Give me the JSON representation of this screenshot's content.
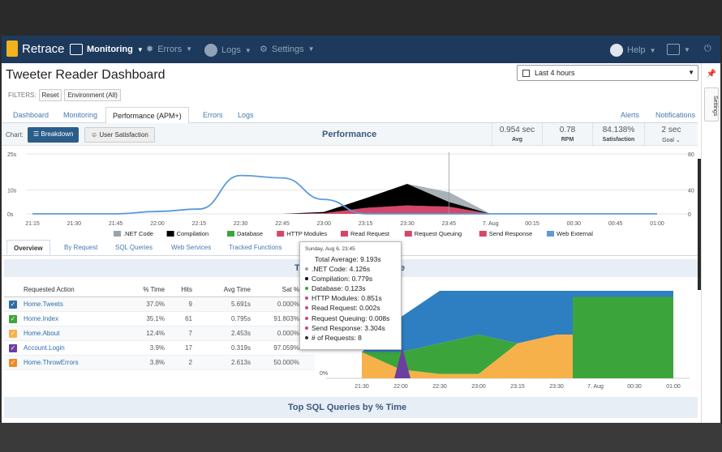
{
  "app": {
    "brand": "Retrace",
    "nav": {
      "monitoring": "Monitoring",
      "errors": "Errors",
      "logs": "Logs",
      "settings": "Settings",
      "help": "Help"
    }
  },
  "page": {
    "title": "Tweeter Reader Dashboard",
    "filters_label": "FILTERS:",
    "filter_reset": "Reset",
    "filter_env": "Environment (All)",
    "time_range": "Last 4 hours"
  },
  "tabs": [
    "Dashboard",
    "Monitoring",
    "Performance (APM+)",
    "Errors",
    "Logs"
  ],
  "tabs_right": {
    "alerts": "Alerts",
    "notifications": "Notifications"
  },
  "chart_bar": {
    "chart_label": "Chart:",
    "breakdown": "Breakdown",
    "user_satisfaction": "User Satisfaction",
    "title": "Performance",
    "stats": [
      {
        "value": "0.954 sec",
        "label": "Avg"
      },
      {
        "value": "0.78",
        "label": "RPM"
      },
      {
        "value": "84.138%",
        "label": "Satisfaction"
      },
      {
        "value": "2 sec",
        "label": "Goal ⌄"
      }
    ]
  },
  "chart_data": [
    {
      "type": "area",
      "title": "Performance",
      "x": [
        "21:15",
        "21:30",
        "21:45",
        "22:00",
        "22:15",
        "22:30",
        "22:45",
        "23:00",
        "23:15",
        "23:30",
        "23:45",
        "7. Aug",
        "00:15",
        "00:30",
        "00:45",
        "01:00"
      ],
      "y_left_ticks": [
        "25s",
        "10s",
        "0s"
      ],
      "y_right_ticks": [
        "80",
        "40",
        "0"
      ],
      "ylim": [
        0,
        25
      ],
      "legend": [
        ".NET Code",
        "Compilation",
        "Database",
        "HTTP Modules",
        "Read Request",
        "Request Queuing",
        "Send Response",
        "Web External"
      ],
      "colors": {
        ".NET Code": "#9aa3ad",
        "Compilation": "#000000",
        "Database": "#3ba53b",
        "HTTP Modules": "#d6466a",
        "Read Request": "#d6466a",
        "Request Queuing": "#d6466a",
        "Send Response": "#d6466a",
        "Web External": "#5b9bd5"
      },
      "series": [
        {
          "name": "Web External",
          "values": [
            0,
            0,
            0,
            1,
            2,
            16,
            15,
            6,
            0,
            0,
            0,
            0,
            0,
            0,
            0,
            0
          ]
        },
        {
          "name": "Compilation",
          "values": [
            0,
            0,
            0,
            0,
            0,
            0,
            0,
            0.5,
            4,
            9,
            2,
            0,
            0,
            0,
            0,
            0
          ]
        },
        {
          "name": "Read Request",
          "values": [
            0,
            0,
            0,
            0,
            0,
            0,
            0,
            0.3,
            2.5,
            3.5,
            3,
            0,
            0,
            0,
            0,
            0
          ]
        },
        {
          "name": ".NET Code",
          "values": [
            0,
            0,
            0,
            0,
            0,
            0,
            0,
            0,
            0,
            0,
            4.1,
            0,
            0,
            0,
            0,
            0
          ]
        }
      ]
    },
    {
      "type": "area",
      "x": [
        "21:30",
        "22:00",
        "22:30",
        "23:00",
        "23:15",
        "23:30",
        "7. Aug",
        "00:30",
        "01:00"
      ],
      "y_ticks": [
        "0%"
      ],
      "series": [
        {
          "name": "Home.Tweets",
          "values": [
            0,
            0.4,
            0.6,
            0.75,
            0.6,
            0.5,
            0.5,
            0.5,
            0.5
          ]
        },
        {
          "name": "Home.Index",
          "values": [
            0,
            0.2,
            0.35,
            0.45,
            0,
            0,
            0,
            0,
            0
          ]
        },
        {
          "name": "Home.About",
          "values": [
            0.3,
            0.1,
            0.05,
            0.05,
            0.4,
            0.5,
            0.5,
            0.5,
            0.5
          ]
        }
      ]
    }
  ],
  "subtabs": [
    "Overview",
    "By Request",
    "SQL Queries",
    "Web Services",
    "Tracked Functions"
  ],
  "section_title": "T",
  "section_title_tail": "e",
  "table": {
    "headers": [
      "Requested Action",
      "% Time",
      "Hits",
      "Avg Time",
      "Sat %"
    ],
    "rows": [
      {
        "action": "Home.Tweets",
        "pct": "37.0%",
        "hits": "9",
        "avg": "5.691s",
        "sat": "0.000%",
        "color": "#2e6ea7"
      },
      {
        "action": "Home.Index",
        "pct": "35.1%",
        "hits": "61",
        "avg": "0.795s",
        "sat": "91.803%",
        "color": "#3ba53b"
      },
      {
        "action": "Home.About",
        "pct": "12.4%",
        "hits": "7",
        "avg": "2.453s",
        "sat": "0.000%",
        "color": "#f7b14a"
      },
      {
        "action": "Account.Login",
        "pct": "3.9%",
        "hits": "17",
        "avg": "0.319s",
        "sat": "97.059%",
        "color": "#6b3fa0"
      },
      {
        "action": "Home.ThrowErrors",
        "pct": "3.8%",
        "hits": "2",
        "avg": "2.613s",
        "sat": "50.000%",
        "color": "#f08a24"
      }
    ]
  },
  "sql_title": "Top SQL Queries by % Time",
  "tooltip": {
    "date": "Sunday, Aug 6, 23:45",
    "total": "Total Average: 9.193s",
    "rows": [
      {
        "label": ".NET Code: 4.126s",
        "color": "#9aa3ad"
      },
      {
        "label": "Compilation: 0.779s",
        "color": "#000000"
      },
      {
        "label": "Database: 0.123s",
        "color": "#3ba53b"
      },
      {
        "label": "HTTP Modules: 0.851s",
        "color": "#d6466a"
      },
      {
        "label": "Read Request: 0.002s",
        "color": "#d6466a"
      },
      {
        "label": "Request Queuing: 0.008s",
        "color": "#d6466a"
      },
      {
        "label": "Send Response: 3.304s",
        "color": "#d6466a"
      },
      {
        "label": "# of Requests: 8",
        "color": "#333333"
      }
    ]
  },
  "side": {
    "settings": "Settings"
  }
}
